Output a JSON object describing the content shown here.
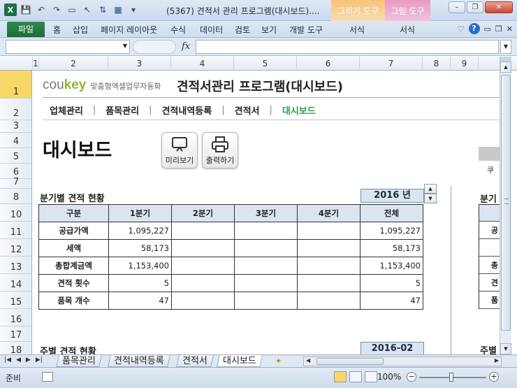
{
  "window": {
    "title": "(5367) 견적서 관리 프로그램(대시보드)....",
    "context_tab_draw": "그리기 도구",
    "context_tab_picture": "그림 도구"
  },
  "ribbon": {
    "file": "파일",
    "tabs": [
      "홈",
      "삽입",
      "페이지 레이아웃",
      "수식",
      "데이터",
      "검토",
      "보기",
      "개발 도구",
      "서식",
      "서식"
    ]
  },
  "formula_bar": {
    "fx": "fx",
    "namebox_value": "",
    "formula_value": ""
  },
  "columns": [
    "1",
    "2",
    "3",
    "4",
    "5",
    "6",
    "7",
    "8",
    "9"
  ],
  "rows": [
    "1",
    "2",
    "3",
    "4",
    "5",
    "6",
    "7",
    "8",
    "10",
    "11",
    "12",
    "13",
    "14",
    "15",
    "16",
    "17",
    "18"
  ],
  "header": {
    "logo_cou": "cou",
    "logo_key": "key",
    "logo_sub": "맞춤형엑셀업무자동화",
    "program_title": "견적서관리 프로그램(대시보드)"
  },
  "nav": {
    "items": [
      "업체관리",
      "품목관리",
      "견적내역등록",
      "견적서",
      "대시보드"
    ],
    "separator": "|"
  },
  "dashboard": {
    "title": "대시보드",
    "preview_button": "미리보기",
    "print_button": "출력하기",
    "right_fragment": "쿠",
    "section1_title": "분기별 견적 현황",
    "section1_right_title": "분기",
    "year_value": "2016 년",
    "section2_title": "주별 견적 현황",
    "section2_right_title": "주별",
    "section2_period": "2016-02"
  },
  "quarter_table": {
    "headers": [
      "구분",
      "1분기",
      "2분기",
      "3분기",
      "4분기",
      "전체"
    ],
    "rows": [
      [
        "공급가액",
        "1,095,227",
        "",
        "",
        "",
        "1,095,227"
      ],
      [
        "세액",
        "58,173",
        "",
        "",
        "",
        "58,173"
      ],
      [
        "총합계금액",
        "1,153,400",
        "",
        "",
        "",
        "1,153,400"
      ],
      [
        "견적 횟수",
        "5",
        "",
        "",
        "",
        "5"
      ],
      [
        "품목 개수",
        "47",
        "",
        "",
        "",
        "47"
      ]
    ],
    "right_fragments": [
      "공",
      "",
      "총",
      "견",
      "품"
    ]
  },
  "sheet_tabs": [
    "품목관리",
    "견적내역등록",
    "견적서",
    "대시보드"
  ],
  "active_sheet": "대시보드",
  "status": {
    "ready": "준비",
    "zoom": "100%"
  }
}
